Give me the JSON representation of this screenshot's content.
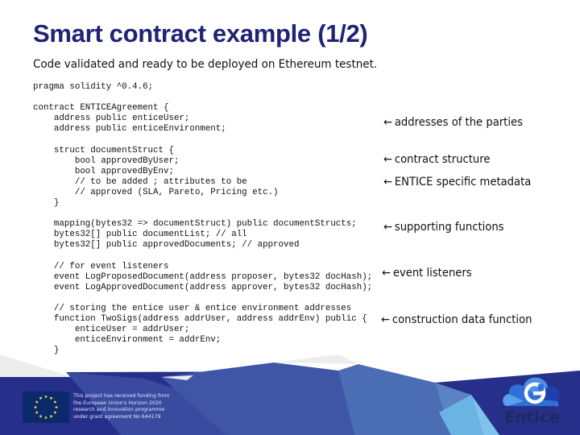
{
  "slide": {
    "title": "Smart contract example (1/2)",
    "subtitle": "Code validated and ready to be deployed on Ethereum testnet."
  },
  "code_lines": [
    "pragma solidity ^0.4.6;",
    "",
    "contract ENTICEAgreement {",
    "    address public enticeUser;",
    "    address public enticeEnvironment;",
    "",
    "    struct documentStruct {",
    "        bool approvedByUser;",
    "        bool approvedByEnv;",
    "        // to be added ; attributes to be",
    "        // approved (SLA, Pareto, Pricing etc.)",
    "    }",
    "",
    "    mapping(bytes32 => documentStruct) public documentStructs;",
    "    bytes32[] public documentList; // all",
    "    bytes32[] public approvedDocuments; // approved",
    "",
    "    // for event listeners",
    "    event LogProposedDocument(address proposer, bytes32 docHash);",
    "    event LogApprovedDocument(address approver, bytes32 docHash);",
    "",
    "    // storing the entice user & entice environment addresses",
    "    function TwoSigs(address addrUser, address addrEnv) public {",
    "        enticeUser = addrUser;",
    "        enticeEnvironment = addrEnv;",
    "    }"
  ],
  "annotations": [
    {
      "arrow": "←",
      "label": "addresses of the parties"
    },
    {
      "arrow": "←",
      "label": "contract structure"
    },
    {
      "arrow": "←",
      "label": "ENTICE specific metadata"
    },
    {
      "arrow": "←",
      "label": "supporting functions"
    },
    {
      "arrow": "←",
      "label": "event listeners"
    },
    {
      "arrow": "←",
      "label": "construction data function"
    }
  ],
  "footer": {
    "eu_flag_icon": "eu-flag-icon",
    "funding_lines": [
      "This project has received funding from",
      "the European Union's Horizon 2020",
      "research and innovation programme",
      "under grant agreement No 644179"
    ],
    "logo_icon": "entice-cloud-logo-icon",
    "logo_text": "Entice"
  },
  "colors": {
    "title": "#1f2373",
    "footer_dark": "#262f8a",
    "footer_mid": "#4a6db3",
    "footer_light": "#6bb3e3",
    "eu_blue": "#0b2a6e",
    "eu_star": "#f2d33a"
  }
}
